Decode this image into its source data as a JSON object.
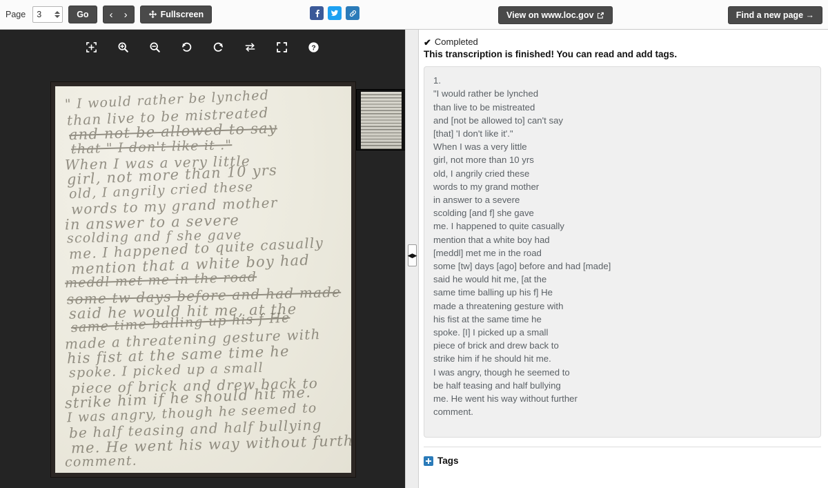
{
  "toolbar": {
    "page_label": "Page",
    "page_value": "3",
    "go_label": "Go",
    "prev_label": "‹",
    "next_label": "›",
    "fullscreen_label": "Fullscreen",
    "fullscreen_icon": "move-arrows-icon",
    "social": [
      {
        "name": "facebook-share-icon",
        "color": "#3b5998"
      },
      {
        "name": "twitter-share-icon",
        "color": "#1da1f2"
      },
      {
        "name": "link-share-icon",
        "color": "#2b7bb9"
      }
    ],
    "view_on_loc_label": "View on www.loc.gov",
    "view_on_loc_icon": "external-link-icon",
    "find_new_page_label": "Find a new page →"
  },
  "viewer": {
    "tools": [
      {
        "name": "fit-to-window-icon",
        "title": "Fit to window"
      },
      {
        "name": "zoom-in-icon",
        "title": "Zoom in"
      },
      {
        "name": "zoom-out-icon",
        "title": "Zoom out"
      },
      {
        "name": "rotate-left-icon",
        "title": "Rotate left"
      },
      {
        "name": "rotate-right-icon",
        "title": "Rotate right"
      },
      {
        "name": "flip-horizontal-icon",
        "title": "Flip"
      },
      {
        "name": "fullscreen-icon",
        "title": "Full screen"
      },
      {
        "name": "help-icon",
        "title": "Help"
      }
    ],
    "background_color": "#242424",
    "manuscript_lines": [
      "\" I would rather be lynched",
      "than live to be mistreated",
      "and not be allowed to say",
      "that \" I don't like it .\"",
      "When I was a very little",
      "girl, not more than 10 yrs",
      "old, I angrily cried these",
      "words to my grand mother",
      "in answer to a severe",
      "scolding and f she gave",
      "me. I happened to quite casually",
      "mention that a white boy had",
      "meddl met me in the road",
      "some tw days before and had made",
      "said he would hit me, at the",
      "same time balling up his f He",
      "made a threatening gesture with",
      "his fist at the same time he",
      "spoke. I picked up a small",
      "piece of brick and drew back to",
      "strike him if he should hit me.",
      "I was angry, though he seemed to",
      "be half teasing and half bullying",
      "me. He went his way without further",
      "comment."
    ]
  },
  "splitter": {
    "grip_icon": "resize-horizontal-icon",
    "grip_glyph": "◀▶"
  },
  "panel": {
    "status_label": "Completed",
    "status_icon": "checkmark-icon",
    "finished_message": "This transcription is finished! You can read and add tags.",
    "transcription_lines": [
      "1.",
      "\"I would rather be lynched",
      "than live to be mistreated",
      "and [not be allowed to] can't say",
      "[that] 'I don't like it'.\"",
      "When I was a very little",
      "girl, not more than 10 yrs",
      "old, I angrily cried these",
      "words to my grand mother",
      "in answer to a severe",
      "scolding [and f] she gave",
      "me. I happened to quite casually",
      "mention that a white boy had",
      "[meddl] met me in the road",
      "some [tw] days [ago] before and had [made]",
      "said he would hit me, [at the",
      "same time balling up his f] He",
      "made a threatening gesture with",
      "his fist at the same time he",
      "spoke. [I] I picked up a small",
      "piece of brick and drew back to",
      "strike him if he should hit me.",
      "I was angry, though he seemed to",
      "be half teasing and half bullying",
      "me. He went his way without further",
      "comment."
    ],
    "tags_label": "Tags",
    "tags_icon": "plus-box-icon"
  }
}
